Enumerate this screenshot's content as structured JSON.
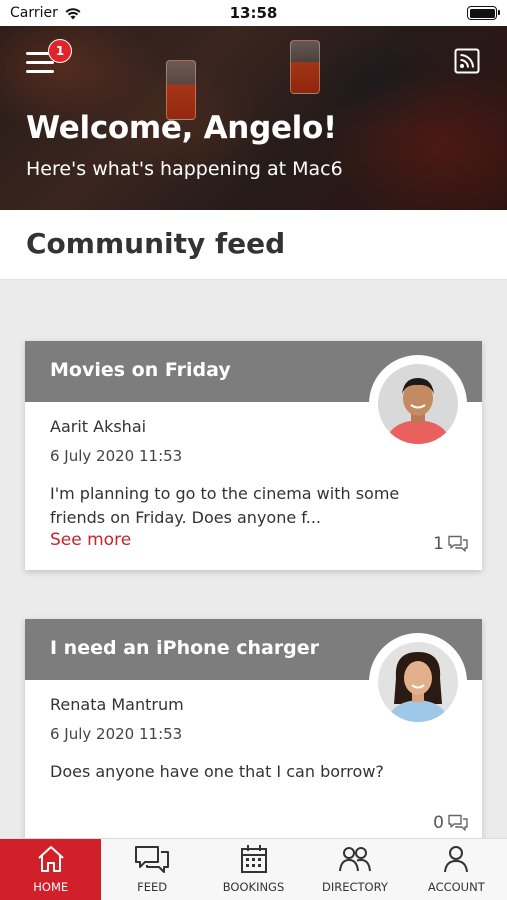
{
  "status_bar": {
    "carrier": "Carrier",
    "time": "13:58"
  },
  "header": {
    "menu_badge_count": "1",
    "welcome": "Welcome, Angelo!",
    "subtitle": "Here's what's happening at Mac6"
  },
  "page_title": "Community feed",
  "feed": [
    {
      "title": "Movies on Friday",
      "author": "Aarit Akshai",
      "date": "6 July 2020 11:53",
      "body": "I'm planning to go to the cinema with some friends on Friday. Does anyone f...",
      "see_more": "See more",
      "comments": "1"
    },
    {
      "title": "I need an iPhone charger",
      "author": "Renata Mantrum",
      "date": "6 July 2020 11:53",
      "body": "Does anyone have one that I can borrow?",
      "comments": "0"
    }
  ],
  "tabs": [
    {
      "label": "HOME",
      "icon": "home-icon",
      "active": true
    },
    {
      "label": "FEED",
      "icon": "chat-icon",
      "active": false
    },
    {
      "label": "BOOKINGS",
      "icon": "calendar-icon",
      "active": false
    },
    {
      "label": "DIRECTORY",
      "icon": "people-icon",
      "active": false
    },
    {
      "label": "ACCOUNT",
      "icon": "person-icon",
      "active": false
    }
  ],
  "colors": {
    "accent": "#d2202a",
    "card_header": "#7d7d7d",
    "link": "#c8232a"
  }
}
